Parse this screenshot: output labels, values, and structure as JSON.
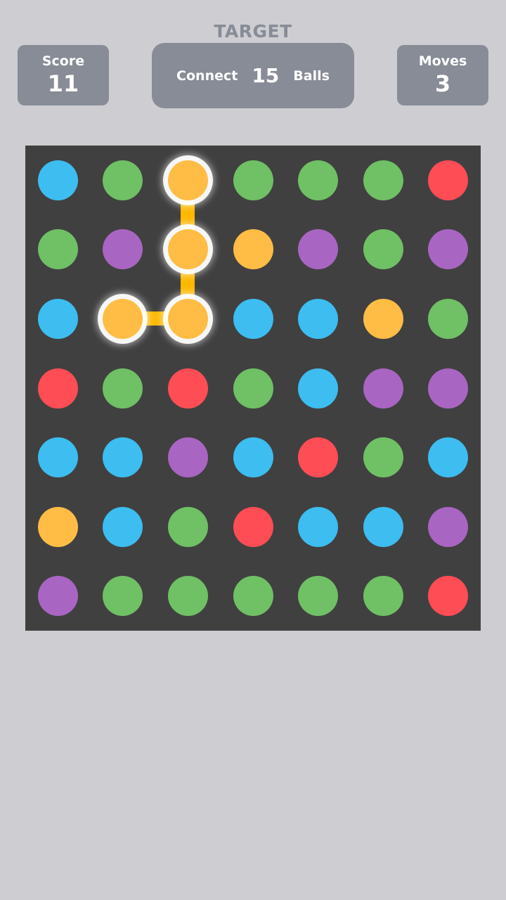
{
  "header": {
    "target_label": "TARGET",
    "score": {
      "label": "Score",
      "value": "11"
    },
    "goal": {
      "prefix": "Connect",
      "count": "15",
      "suffix": "Balls"
    },
    "moves": {
      "label": "Moves",
      "value": "3"
    }
  },
  "colors": {
    "b": "#3dbdf0",
    "g": "#70c065",
    "y": "#ffbd45",
    "r": "#ff4d55",
    "p": "#a965c2",
    "link": "#ffb800"
  },
  "color_names": {
    "b": "blue",
    "g": "green",
    "y": "yellow",
    "r": "red",
    "p": "purple"
  },
  "board": {
    "rows": 7,
    "cols": 7,
    "grid": [
      [
        "b",
        "g",
        "y",
        "g",
        "g",
        "g",
        "r"
      ],
      [
        "g",
        "p",
        "y",
        "y",
        "p",
        "g",
        "p"
      ],
      [
        "b",
        "y",
        "y",
        "b",
        "b",
        "y",
        "g"
      ],
      [
        "r",
        "g",
        "r",
        "g",
        "b",
        "p",
        "p"
      ],
      [
        "b",
        "b",
        "p",
        "b",
        "r",
        "g",
        "b"
      ],
      [
        "y",
        "b",
        "g",
        "r",
        "b",
        "b",
        "p"
      ],
      [
        "p",
        "g",
        "g",
        "g",
        "g",
        "g",
        "r"
      ]
    ],
    "selected_path": [
      [
        0,
        2
      ],
      [
        1,
        2
      ],
      [
        2,
        2
      ],
      [
        2,
        1
      ]
    ]
  }
}
